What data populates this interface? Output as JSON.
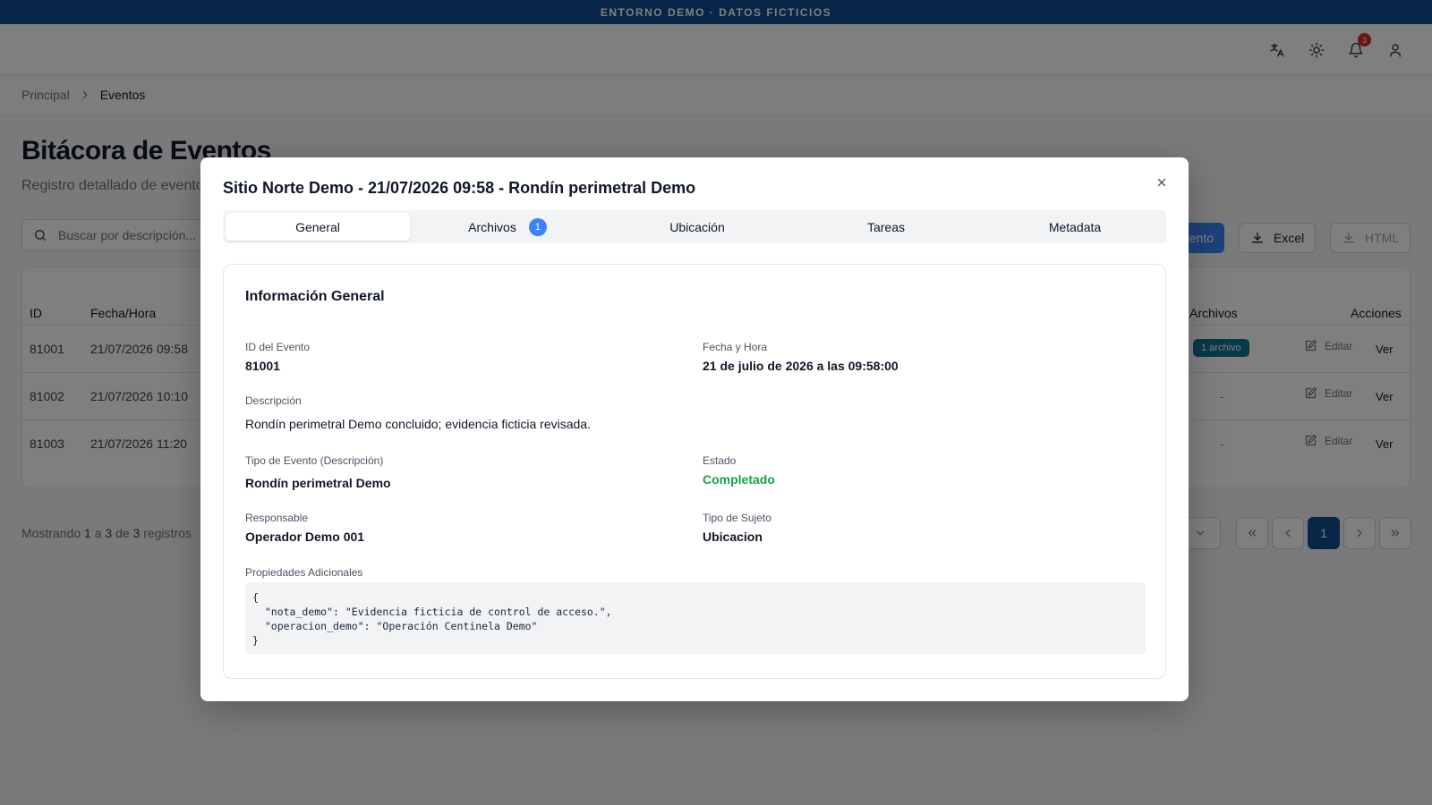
{
  "banner": {
    "text": "ENTORNO DEMO · DATOS FICTICIOS"
  },
  "topbar": {
    "notifications_count": "3"
  },
  "breadcrumb": {
    "home": "Principal",
    "current": "Eventos"
  },
  "page": {
    "title": "Bitácora de Eventos",
    "subtitle": "Registro detallado de eventos"
  },
  "toolbar": {
    "search_placeholder": "Buscar por descripción...",
    "new_label": "ento",
    "excel_label": "Excel",
    "html_label": "HTML"
  },
  "table": {
    "columns": {
      "id": "ID",
      "datetime": "Fecha/Hora",
      "files": "Archivos",
      "actions": "Acciones"
    },
    "rows": [
      {
        "id": "81001",
        "datetime": "21/07/2026 09:58",
        "files": "1 archivo",
        "edit": "Editar",
        "view": "Ver"
      },
      {
        "id": "81002",
        "datetime": "21/07/2026 10:10",
        "files": "-",
        "edit": "Editar",
        "view": "Ver"
      },
      {
        "id": "81003",
        "datetime": "21/07/2026 11:20",
        "files": "-",
        "edit": "Editar",
        "view": "Ver"
      }
    ]
  },
  "pagination": {
    "showing": "Mostrando",
    "from": "1",
    "to_word": "a",
    "to": "3",
    "of_word": "de",
    "total": "3",
    "records": "registros",
    "current_page": "1"
  },
  "modal": {
    "title": "Sitio Norte Demo - 21/07/2026 09:58 - Rondín perimetral Demo",
    "tabs": [
      {
        "label": "General"
      },
      {
        "label": "Archivos",
        "badge": "1"
      },
      {
        "label": "Ubicación"
      },
      {
        "label": "Tareas"
      },
      {
        "label": "Metadata"
      }
    ],
    "card_title": "Información General",
    "fields": {
      "event_id_label": "ID del Evento",
      "event_id": "81001",
      "datetime_label": "Fecha y Hora",
      "datetime": "21 de julio de 2026 a las 09:58:00",
      "description_label": "Descripción",
      "description": "Rondín perimetral Demo concluido; evidencia ficticia revisada.",
      "event_type_label": "Tipo de Evento (Descripción)",
      "event_type": "Rondín perimetral Demo",
      "status_label": "Estado",
      "status": "Completado",
      "responsible_label": "Responsable",
      "responsible": "Operador Demo 001",
      "subject_type_label": "Tipo de Sujeto",
      "subject_type": "Ubicacion",
      "extra_props_label": "Propiedades Adicionales",
      "extra_props": "{\n  \"nota_demo\": \"Evidencia ficticia de control de acceso.\",\n  \"operacion_demo\": \"Operación Centinela Demo\"\n}"
    }
  },
  "colors": {
    "banner": "#0f4c91",
    "accent": "#3b82f6",
    "files_pill": "#0e7490",
    "status_ok": "#16a34a",
    "notification": "#dc2626"
  },
  "icons": [
    "translate-icon",
    "sun-icon",
    "bell-icon",
    "user-icon",
    "chevron-right-icon",
    "search-icon",
    "download-icon",
    "edit-icon",
    "close-icon",
    "chevron-down-icon",
    "chevrons-left-icon",
    "chevron-left-icon",
    "chevrons-right-icon"
  ]
}
